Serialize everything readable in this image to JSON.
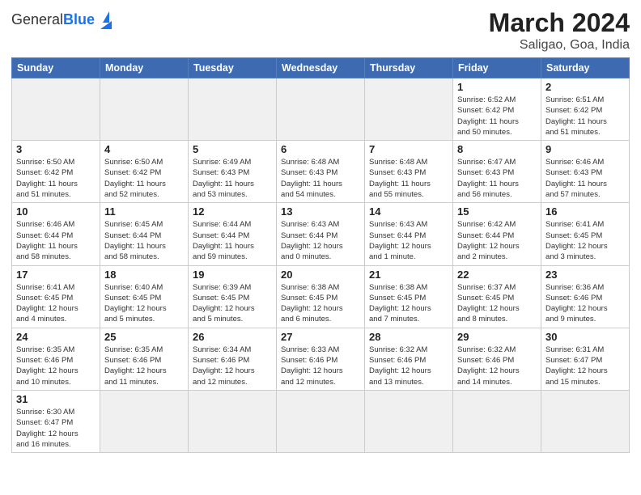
{
  "header": {
    "logo_text_regular": "General",
    "logo_text_blue": "Blue",
    "title": "March 2024",
    "subtitle": "Saligao, Goa, India"
  },
  "days_of_week": [
    "Sunday",
    "Monday",
    "Tuesday",
    "Wednesday",
    "Thursday",
    "Friday",
    "Saturday"
  ],
  "weeks": [
    [
      {
        "day": "",
        "empty": true
      },
      {
        "day": "",
        "empty": true
      },
      {
        "day": "",
        "empty": true
      },
      {
        "day": "",
        "empty": true
      },
      {
        "day": "",
        "empty": true
      },
      {
        "day": "1",
        "info": "Sunrise: 6:52 AM\nSunset: 6:42 PM\nDaylight: 11 hours\nand 50 minutes."
      },
      {
        "day": "2",
        "info": "Sunrise: 6:51 AM\nSunset: 6:42 PM\nDaylight: 11 hours\nand 51 minutes."
      }
    ],
    [
      {
        "day": "3",
        "info": "Sunrise: 6:50 AM\nSunset: 6:42 PM\nDaylight: 11 hours\nand 51 minutes."
      },
      {
        "day": "4",
        "info": "Sunrise: 6:50 AM\nSunset: 6:42 PM\nDaylight: 11 hours\nand 52 minutes."
      },
      {
        "day": "5",
        "info": "Sunrise: 6:49 AM\nSunset: 6:43 PM\nDaylight: 11 hours\nand 53 minutes."
      },
      {
        "day": "6",
        "info": "Sunrise: 6:48 AM\nSunset: 6:43 PM\nDaylight: 11 hours\nand 54 minutes."
      },
      {
        "day": "7",
        "info": "Sunrise: 6:48 AM\nSunset: 6:43 PM\nDaylight: 11 hours\nand 55 minutes."
      },
      {
        "day": "8",
        "info": "Sunrise: 6:47 AM\nSunset: 6:43 PM\nDaylight: 11 hours\nand 56 minutes."
      },
      {
        "day": "9",
        "info": "Sunrise: 6:46 AM\nSunset: 6:43 PM\nDaylight: 11 hours\nand 57 minutes."
      }
    ],
    [
      {
        "day": "10",
        "info": "Sunrise: 6:46 AM\nSunset: 6:44 PM\nDaylight: 11 hours\nand 58 minutes."
      },
      {
        "day": "11",
        "info": "Sunrise: 6:45 AM\nSunset: 6:44 PM\nDaylight: 11 hours\nand 58 minutes."
      },
      {
        "day": "12",
        "info": "Sunrise: 6:44 AM\nSunset: 6:44 PM\nDaylight: 11 hours\nand 59 minutes."
      },
      {
        "day": "13",
        "info": "Sunrise: 6:43 AM\nSunset: 6:44 PM\nDaylight: 12 hours\nand 0 minutes."
      },
      {
        "day": "14",
        "info": "Sunrise: 6:43 AM\nSunset: 6:44 PM\nDaylight: 12 hours\nand 1 minute."
      },
      {
        "day": "15",
        "info": "Sunrise: 6:42 AM\nSunset: 6:44 PM\nDaylight: 12 hours\nand 2 minutes."
      },
      {
        "day": "16",
        "info": "Sunrise: 6:41 AM\nSunset: 6:45 PM\nDaylight: 12 hours\nand 3 minutes."
      }
    ],
    [
      {
        "day": "17",
        "info": "Sunrise: 6:41 AM\nSunset: 6:45 PM\nDaylight: 12 hours\nand 4 minutes."
      },
      {
        "day": "18",
        "info": "Sunrise: 6:40 AM\nSunset: 6:45 PM\nDaylight: 12 hours\nand 5 minutes."
      },
      {
        "day": "19",
        "info": "Sunrise: 6:39 AM\nSunset: 6:45 PM\nDaylight: 12 hours\nand 5 minutes."
      },
      {
        "day": "20",
        "info": "Sunrise: 6:38 AM\nSunset: 6:45 PM\nDaylight: 12 hours\nand 6 minutes."
      },
      {
        "day": "21",
        "info": "Sunrise: 6:38 AM\nSunset: 6:45 PM\nDaylight: 12 hours\nand 7 minutes."
      },
      {
        "day": "22",
        "info": "Sunrise: 6:37 AM\nSunset: 6:45 PM\nDaylight: 12 hours\nand 8 minutes."
      },
      {
        "day": "23",
        "info": "Sunrise: 6:36 AM\nSunset: 6:46 PM\nDaylight: 12 hours\nand 9 minutes."
      }
    ],
    [
      {
        "day": "24",
        "info": "Sunrise: 6:35 AM\nSunset: 6:46 PM\nDaylight: 12 hours\nand 10 minutes."
      },
      {
        "day": "25",
        "info": "Sunrise: 6:35 AM\nSunset: 6:46 PM\nDaylight: 12 hours\nand 11 minutes."
      },
      {
        "day": "26",
        "info": "Sunrise: 6:34 AM\nSunset: 6:46 PM\nDaylight: 12 hours\nand 12 minutes."
      },
      {
        "day": "27",
        "info": "Sunrise: 6:33 AM\nSunset: 6:46 PM\nDaylight: 12 hours\nand 12 minutes."
      },
      {
        "day": "28",
        "info": "Sunrise: 6:32 AM\nSunset: 6:46 PM\nDaylight: 12 hours\nand 13 minutes."
      },
      {
        "day": "29",
        "info": "Sunrise: 6:32 AM\nSunset: 6:46 PM\nDaylight: 12 hours\nand 14 minutes."
      },
      {
        "day": "30",
        "info": "Sunrise: 6:31 AM\nSunset: 6:47 PM\nDaylight: 12 hours\nand 15 minutes."
      }
    ],
    [
      {
        "day": "31",
        "info": "Sunrise: 6:30 AM\nSunset: 6:47 PM\nDaylight: 12 hours\nand 16 minutes."
      },
      {
        "day": "",
        "empty": true
      },
      {
        "day": "",
        "empty": true
      },
      {
        "day": "",
        "empty": true
      },
      {
        "day": "",
        "empty": true
      },
      {
        "day": "",
        "empty": true
      },
      {
        "day": "",
        "empty": true
      }
    ]
  ]
}
